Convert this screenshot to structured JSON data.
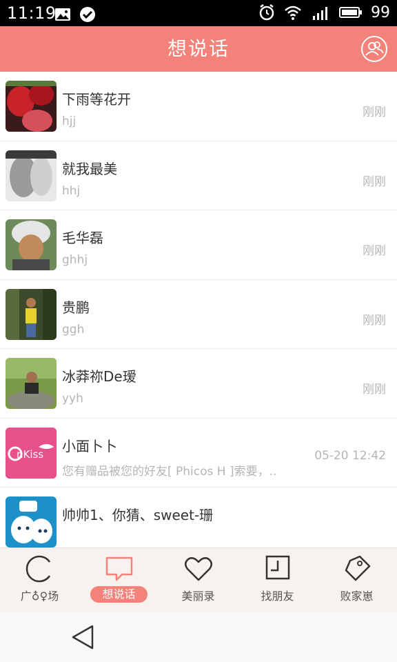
{
  "status_bar": {
    "time": "11:19",
    "battery": "99"
  },
  "header": {
    "title": "想说话"
  },
  "conversations": [
    {
      "name": "下雨等花开",
      "preview": "hjj",
      "time": "刚刚"
    },
    {
      "name": "就我最美",
      "preview": "hhj",
      "time": "刚刚"
    },
    {
      "name": "毛华磊",
      "preview": "ghhj",
      "time": "刚刚"
    },
    {
      "name": "贵鹏",
      "preview": "ggh",
      "time": "刚刚"
    },
    {
      "name": "冰莽祢De瑷",
      "preview": "yyh",
      "time": "刚刚"
    },
    {
      "name": "小面卜卜",
      "preview": "您有赠品被您的好友[ Phicos H ]索要，..",
      "time": "05-20 12:42",
      "avatar_text": "nKiss"
    },
    {
      "name": "帅帅1、你猜、sweet-珊",
      "preview": "",
      "time": ""
    }
  ],
  "tabs": [
    {
      "label": "广♁♀场"
    },
    {
      "label": "想说话"
    },
    {
      "label": "美丽录"
    },
    {
      "label": "找朋友"
    },
    {
      "label": "败家崽"
    }
  ],
  "colors": {
    "accent": "#f2827a",
    "tabbar_bg": "#f7f2ee"
  }
}
